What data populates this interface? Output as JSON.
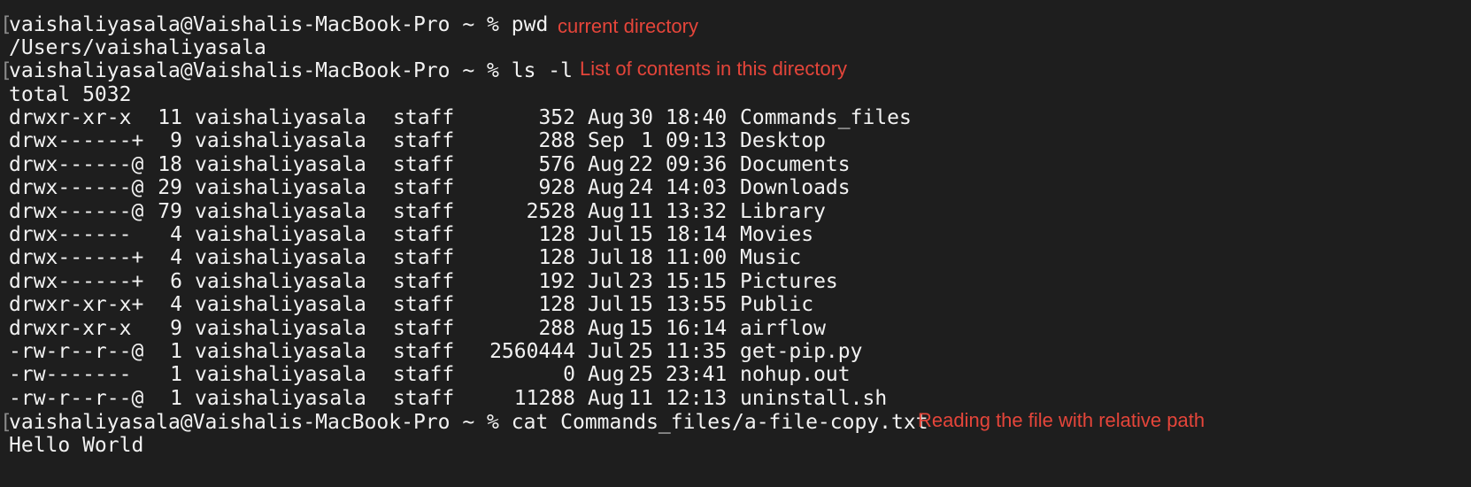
{
  "prompt": "vaishaliyasala@Vaishalis-MacBook-Pro ~ %",
  "bracket": "[",
  "commands": [
    {
      "cmd": "pwd",
      "note": "current directory"
    },
    {
      "cmd": "ls -l",
      "note": "List of contents in this directory"
    },
    {
      "cmd": "cat Commands_files/a-file-copy.txt",
      "note": "Reading the file with relative path"
    }
  ],
  "outputs": {
    "pwd": "/Users/vaishaliyasala",
    "ls_total": "total 5032",
    "cat": "Hello World"
  },
  "ls_rows": [
    {
      "perm": "drwxr-xr-x",
      "links": "11",
      "owner": "vaishaliyasala",
      "group": "staff",
      "size": "352",
      "month": "Aug",
      "day": "30",
      "time": "18:40",
      "name": "Commands_files"
    },
    {
      "perm": "drwx------+",
      "links": "9",
      "owner": "vaishaliyasala",
      "group": "staff",
      "size": "288",
      "month": "Sep",
      "day": "1",
      "time": "09:13",
      "name": "Desktop"
    },
    {
      "perm": "drwx------@",
      "links": "18",
      "owner": "vaishaliyasala",
      "group": "staff",
      "size": "576",
      "month": "Aug",
      "day": "22",
      "time": "09:36",
      "name": "Documents"
    },
    {
      "perm": "drwx------@",
      "links": "29",
      "owner": "vaishaliyasala",
      "group": "staff",
      "size": "928",
      "month": "Aug",
      "day": "24",
      "time": "14:03",
      "name": "Downloads"
    },
    {
      "perm": "drwx------@",
      "links": "79",
      "owner": "vaishaliyasala",
      "group": "staff",
      "size": "2528",
      "month": "Aug",
      "day": "11",
      "time": "13:32",
      "name": "Library"
    },
    {
      "perm": "drwx------",
      "links": "4",
      "owner": "vaishaliyasala",
      "group": "staff",
      "size": "128",
      "month": "Jul",
      "day": "15",
      "time": "18:14",
      "name": "Movies"
    },
    {
      "perm": "drwx------+",
      "links": "4",
      "owner": "vaishaliyasala",
      "group": "staff",
      "size": "128",
      "month": "Jul",
      "day": "18",
      "time": "11:00",
      "name": "Music"
    },
    {
      "perm": "drwx------+",
      "links": "6",
      "owner": "vaishaliyasala",
      "group": "staff",
      "size": "192",
      "month": "Jul",
      "day": "23",
      "time": "15:15",
      "name": "Pictures"
    },
    {
      "perm": "drwxr-xr-x+",
      "links": "4",
      "owner": "vaishaliyasala",
      "group": "staff",
      "size": "128",
      "month": "Jul",
      "day": "15",
      "time": "13:55",
      "name": "Public"
    },
    {
      "perm": "drwxr-xr-x",
      "links": "9",
      "owner": "vaishaliyasala",
      "group": "staff",
      "size": "288",
      "month": "Aug",
      "day": "15",
      "time": "16:14",
      "name": "airflow"
    },
    {
      "perm": "-rw-r--r--@",
      "links": "1",
      "owner": "vaishaliyasala",
      "group": "staff",
      "size": "2560444",
      "month": "Jul",
      "day": "25",
      "time": "11:35",
      "name": "get-pip.py"
    },
    {
      "perm": "-rw-------",
      "links": "1",
      "owner": "vaishaliyasala",
      "group": "staff",
      "size": "0",
      "month": "Aug",
      "day": "25",
      "time": "23:41",
      "name": "nohup.out"
    },
    {
      "perm": "-rw-r--r--@",
      "links": "1",
      "owner": "vaishaliyasala",
      "group": "staff",
      "size": "11288",
      "month": "Aug",
      "day": "11",
      "time": "12:13",
      "name": "uninstall.sh"
    }
  ]
}
